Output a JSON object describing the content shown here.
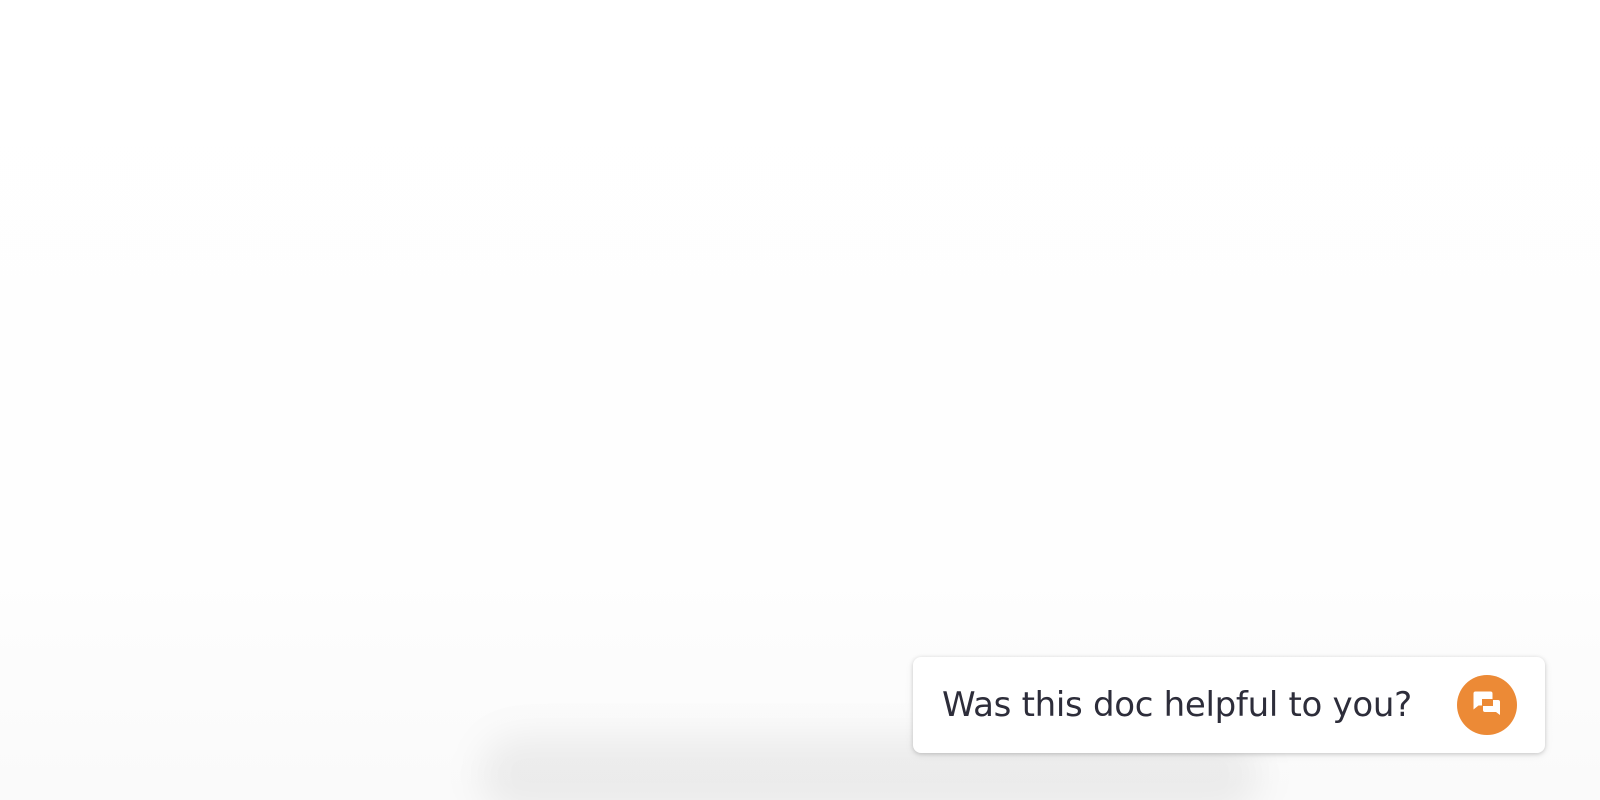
{
  "feedback": {
    "prompt": "Was this doc helpful to you?",
    "button_icon": "chat-bubbles-icon",
    "accent_color": "#ec8a36"
  }
}
